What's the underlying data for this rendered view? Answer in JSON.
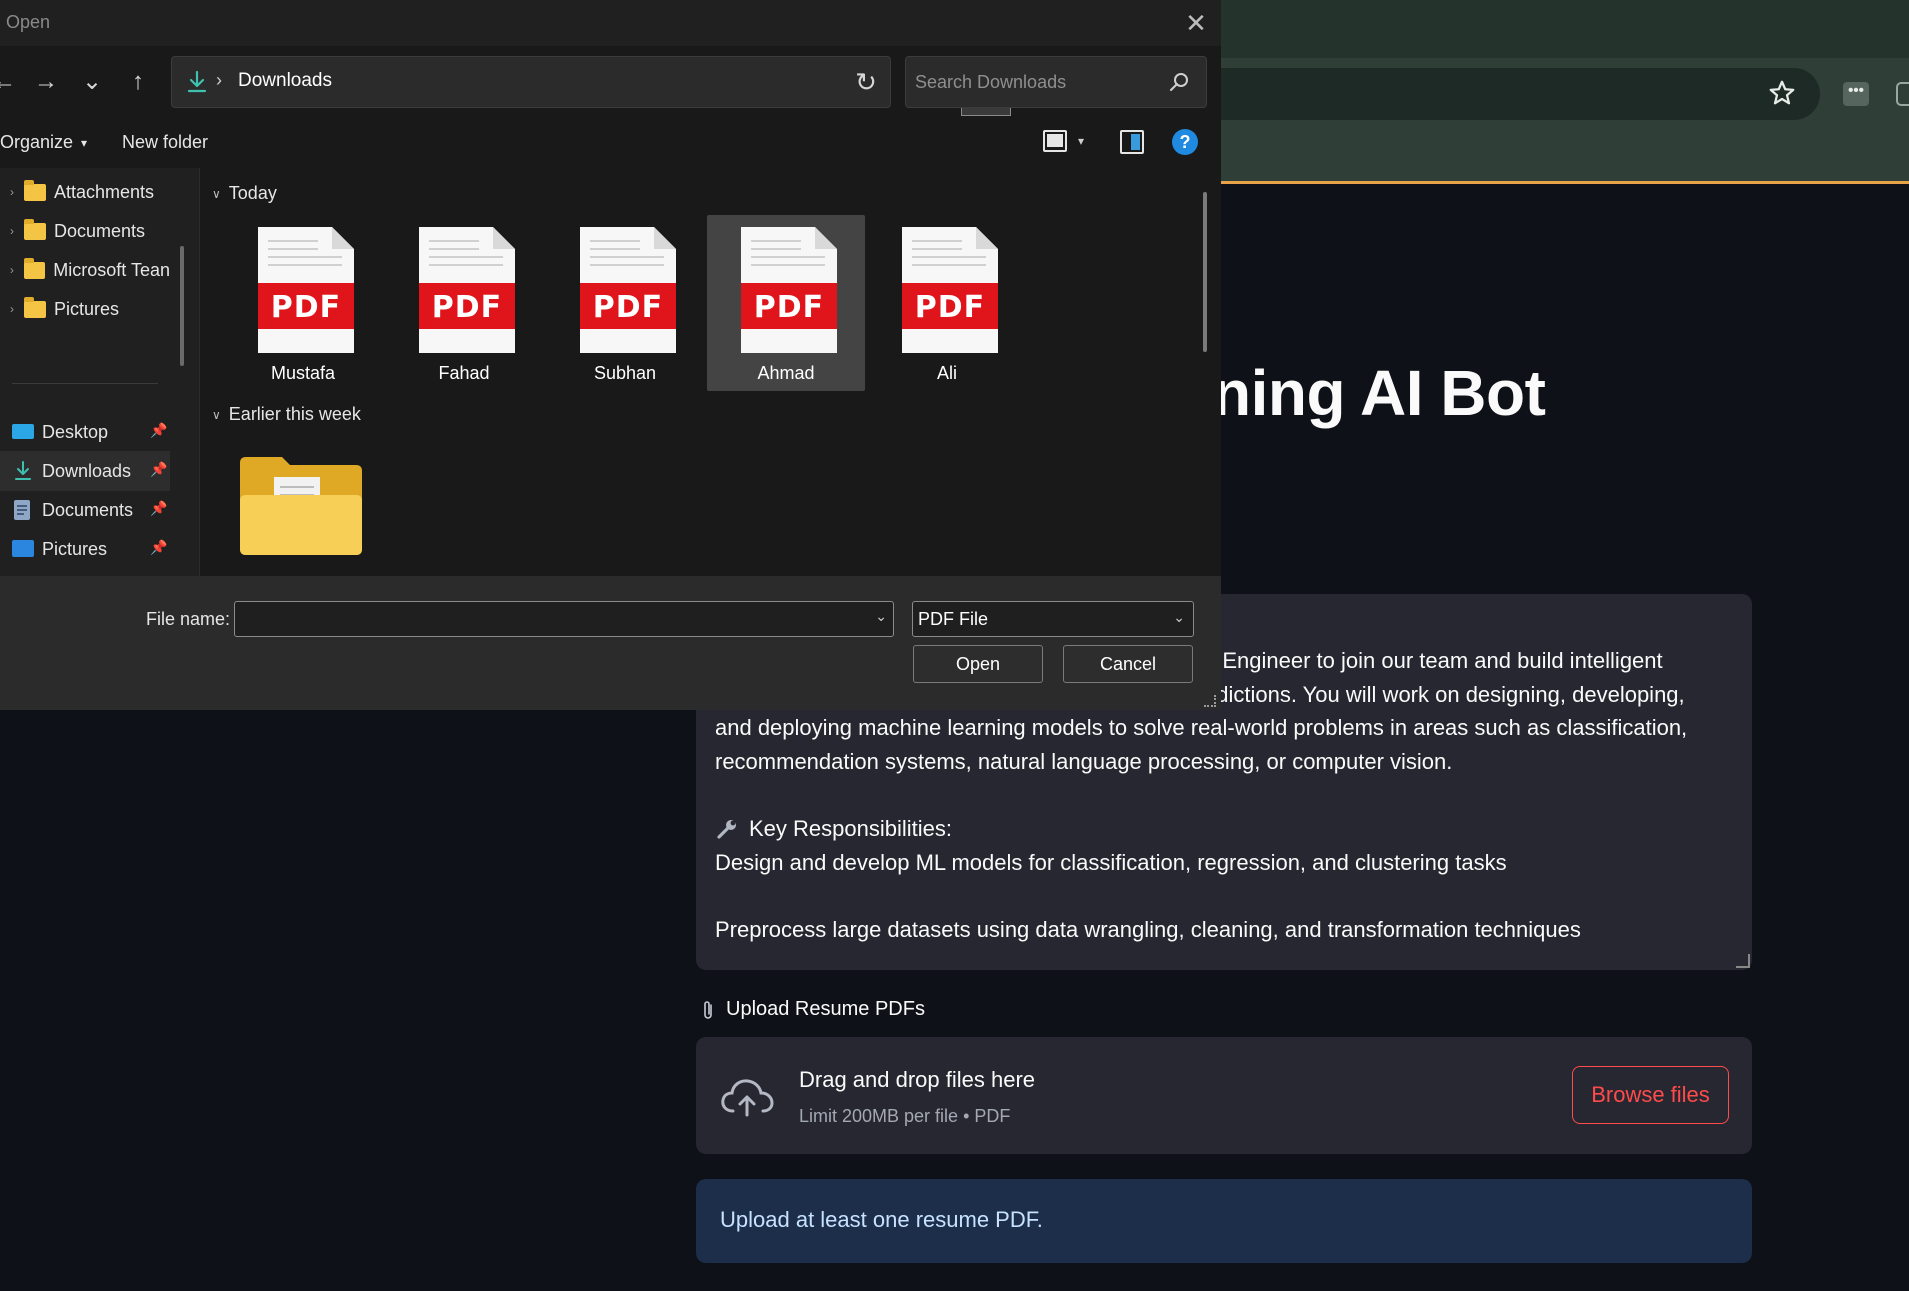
{
  "browser": {
    "ext_label": "•••"
  },
  "app": {
    "title": "ning AI Bot",
    "job_description": {
      "line1": "g Engineer to join our team and build intelligent",
      "line2": "edictions. You will work on designing, developing,",
      "line3": "and deploying machine learning models to solve real-world problems in areas such as classification,",
      "line4": "recommendation systems, natural language processing, or computer vision.",
      "heading_icon": "wrench-icon",
      "heading": "Key Responsibilities:",
      "line5": "Design and develop ML models for classification, regression, and clustering tasks",
      "line6": "Preprocess large datasets using data wrangling, cleaning, and transformation techniques"
    },
    "upload": {
      "label_icon": "paperclip-icon",
      "label": "Upload Resume PDFs",
      "drop_title": "Drag and drop files here",
      "drop_sub": "Limit 200MB per file • PDF",
      "browse_label": "Browse files"
    },
    "info": "Upload at least one resume PDF."
  },
  "dialog": {
    "title": "Open",
    "close": "✕",
    "nav": {
      "back": "←",
      "forward": "→",
      "recent": "⌄",
      "up": "↑",
      "refresh": "↻"
    },
    "address": {
      "separator": "›",
      "location": "Downloads",
      "dropdown": "⌄"
    },
    "search": {
      "placeholder": "Search Downloads"
    },
    "toolbar": {
      "organize": "Organize",
      "organize_caret": "▾",
      "new_folder": "New folder",
      "view_caret": "▾",
      "help": "?"
    },
    "nav_pane": {
      "tree": [
        {
          "label": "Attachments"
        },
        {
          "label": "Documents"
        },
        {
          "label": "Microsoft Tean"
        },
        {
          "label": "Pictures"
        }
      ],
      "quick_access": [
        {
          "label": "Desktop"
        },
        {
          "label": "Downloads"
        },
        {
          "label": "Documents"
        },
        {
          "label": "Pictures"
        }
      ],
      "chevron": "›",
      "pin": "📌"
    },
    "groups": {
      "today": "Today",
      "earlier": "Earlier this week",
      "chevron": "∨"
    },
    "files": [
      {
        "name": "Mustafa",
        "selected": false
      },
      {
        "name": "Fahad",
        "selected": false
      },
      {
        "name": "Subhan",
        "selected": false
      },
      {
        "name": "Ahmad",
        "selected": true
      },
      {
        "name": "Ali",
        "selected": false
      }
    ],
    "pdf_badge": "PDF",
    "bottom": {
      "filename_label": "File name:",
      "filename_value": "",
      "caret": "⌄",
      "filetype": "PDF File",
      "open": "Open",
      "cancel": "Cancel"
    }
  }
}
